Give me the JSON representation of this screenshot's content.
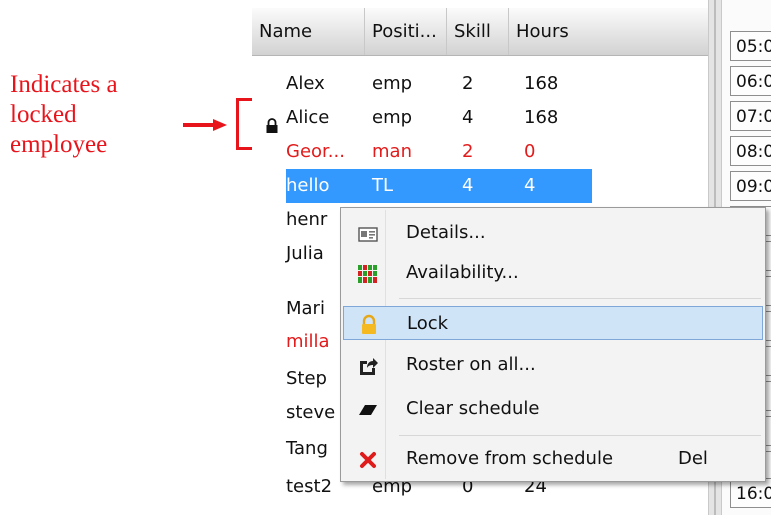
{
  "annotation": {
    "text": "Indicates a\nlocked\nemployee"
  },
  "grid": {
    "columns": [
      "Name",
      "Positi...",
      "Skill",
      "Hours"
    ],
    "rows": [
      {
        "name": "Alex",
        "position": "emp",
        "skill": "2",
        "hours": "168",
        "style": "normal"
      },
      {
        "name": "Alice",
        "position": "emp",
        "skill": "4",
        "hours": "168",
        "style": "normal",
        "locked": true
      },
      {
        "name": "Geor...",
        "position": "man",
        "skill": "2",
        "hours": "0",
        "style": "red"
      },
      {
        "name": "hello",
        "position": "TL",
        "skill": "4",
        "hours": "4",
        "style": "selected"
      },
      {
        "name": "henr",
        "position": "",
        "skill": "",
        "hours": "",
        "style": "normal"
      },
      {
        "name": "Julia",
        "position": "",
        "skill": "",
        "hours": "",
        "style": "normal"
      },
      {
        "name": "Mari",
        "position": "",
        "skill": "",
        "hours": "",
        "style": "normal"
      },
      {
        "name": "milla",
        "position": "",
        "skill": "",
        "hours": "",
        "style": "red"
      },
      {
        "name": "Step",
        "position": "",
        "skill": "",
        "hours": "",
        "style": "normal"
      },
      {
        "name": "steve",
        "position": "",
        "skill": "",
        "hours": "",
        "style": "normal"
      },
      {
        "name": "Tang",
        "position": "",
        "skill": "",
        "hours": "",
        "style": "normal"
      },
      {
        "name": "test2",
        "position": "emp",
        "skill": "0",
        "hours": "24",
        "style": "normal"
      }
    ]
  },
  "times": [
    "05:0",
    "06:0",
    "07:0",
    "08:0",
    "09:0",
    "",
    "",
    "",
    "",
    "",
    "",
    "",
    "",
    "16:0"
  ],
  "context_menu": {
    "items": [
      {
        "label": "Details...",
        "icon": "id-card-icon",
        "shortcut": ""
      },
      {
        "label": "Availability...",
        "icon": "availability-grid-icon",
        "shortcut": ""
      },
      {
        "label": "Lock",
        "icon": "lock-icon",
        "shortcut": "",
        "highlighted": true
      },
      {
        "label": "Roster on all...",
        "icon": "share-icon",
        "shortcut": ""
      },
      {
        "label": "Clear schedule",
        "icon": "eraser-icon",
        "shortcut": ""
      },
      {
        "label": "Remove from schedule",
        "icon": "red-x-icon",
        "shortcut": "Del"
      }
    ]
  },
  "colors": {
    "annotation": "#e8141c",
    "selection": "#3399ff",
    "red_text": "#e21c1c",
    "menu_highlight": "#d0e4f7"
  }
}
